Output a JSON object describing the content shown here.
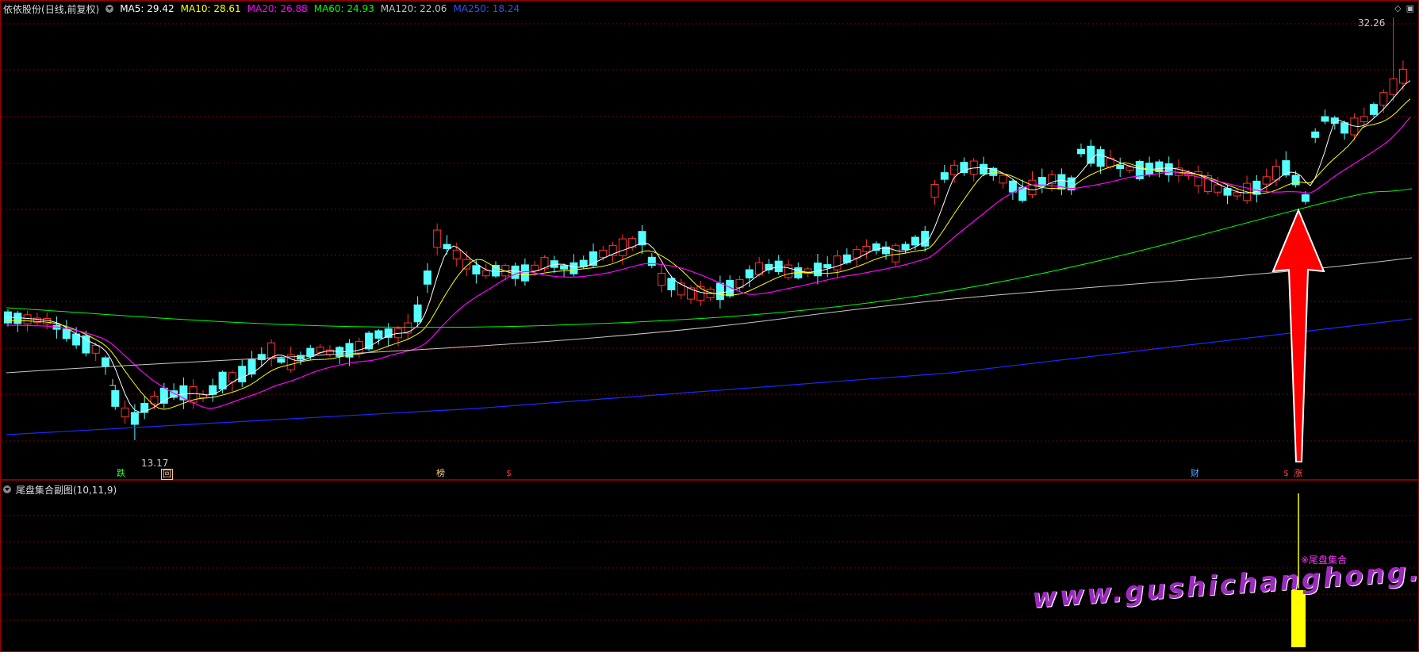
{
  "main_chart": {
    "stock_name": "依依股份",
    "mode": "(日线,前复权)",
    "ma": [
      {
        "label": "MA5: 29.42",
        "color": "#ffffff"
      },
      {
        "label": "MA10: 28.61",
        "color": "#ffff00"
      },
      {
        "label": "MA20: 26.88",
        "color": "#ff00ff"
      },
      {
        "label": "MA60: 24.93",
        "color": "#00ff00"
      },
      {
        "label": "MA120: 22.06",
        "color": "#c0c0c0"
      },
      {
        "label": "MA250: 18.24",
        "color": "#0000ff"
      }
    ],
    "high_label": "32.26",
    "low_label": "13.17",
    "markers": [
      "跌",
      "回",
      "榜",
      "$",
      "财",
      "$",
      "涨"
    ]
  },
  "sub_chart": {
    "title": "尾盘集合副图(10,11,9)",
    "signal_label": "※尾盘集合"
  },
  "watermark": "www.gushichanghong.com",
  "colors": {
    "up": "#ff3232",
    "down": "#54ffff",
    "grid": "#7a0000",
    "arrow": "#ff0000",
    "bar": "#ffff00"
  }
}
